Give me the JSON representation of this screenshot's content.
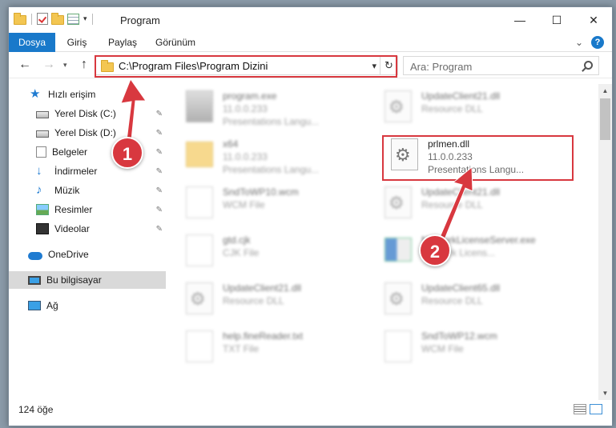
{
  "window": {
    "title": "Program",
    "minimize": "—",
    "maximize": "☐",
    "close": "✕"
  },
  "ribbon": {
    "tabs": [
      "Dosya",
      "Giriş",
      "Paylaş",
      "Görünüm"
    ],
    "expand_icon": "chevron-down-icon",
    "help_label": "?"
  },
  "navigation": {
    "back": "←",
    "forward": "→",
    "recent": "⌄",
    "up": "↑",
    "address": "C:\\Program Files\\Program Dizini",
    "address_dropdown": "⌄",
    "refresh": "↻",
    "search_placeholder": "Ara: Program"
  },
  "sidebar": {
    "items": [
      {
        "label": "Hızlı erişim",
        "icon": "star-icon",
        "pinned": false
      },
      {
        "label": "Yerel Disk (C:)",
        "icon": "drive-icon",
        "pinned": true
      },
      {
        "label": "Yerel Disk (D:)",
        "icon": "drive-icon",
        "pinned": true
      },
      {
        "label": "Belgeler",
        "icon": "documents-icon",
        "pinned": true
      },
      {
        "label": "İndirmeler",
        "icon": "downloads-icon",
        "pinned": true
      },
      {
        "label": "Müzik",
        "icon": "music-icon",
        "pinned": true
      },
      {
        "label": "Resimler",
        "icon": "pictures-icon",
        "pinned": true
      },
      {
        "label": "Videolar",
        "icon": "videos-icon",
        "pinned": true
      },
      {
        "label": "OneDrive",
        "icon": "onedrive-icon",
        "pinned": false
      },
      {
        "label": "Bu bilgisayar",
        "icon": "this-pc-icon",
        "pinned": false,
        "selected": true
      },
      {
        "label": "Ağ",
        "icon": "network-icon",
        "pinned": false
      }
    ],
    "pin_glyph": "📌"
  },
  "files": [
    {
      "name": "program.exe",
      "meta1": "11.0.0.233",
      "meta2": "Presentations Langu...",
      "icon": "exe-icon"
    },
    {
      "name": "UpdateClient21.dll",
      "meta1": "Resource DLL",
      "meta2": "",
      "icon": "dll-icon"
    },
    {
      "name": "x64",
      "meta1": "11.0.0.233",
      "meta2": "Presentations Langu...",
      "icon": "folder-icon"
    },
    {
      "name": "prlmen.dll",
      "meta1": "11.0.0.233",
      "meta2": "Presentations Langu...",
      "icon": "dll-icon",
      "highlighted": true
    },
    {
      "name": "SndToWP10.wcm",
      "meta1": "WCM File",
      "meta2": "",
      "icon": "file-icon"
    },
    {
      "name": "UpdateClient21.dll",
      "meta1": "Resource DLL",
      "meta2": "",
      "icon": "dll-icon"
    },
    {
      "name": "gtd.cjk",
      "meta1": "CJK File",
      "meta2": "",
      "icon": "file-icon"
    },
    {
      "name": "NetworkLicenseServer.exe",
      "meta1": "Network Licens...",
      "meta2": "",
      "icon": "app-icon"
    },
    {
      "name": "UpdateClient21.dll",
      "meta1": "Resource DLL",
      "meta2": "",
      "icon": "dll-icon"
    },
    {
      "name": "UpdateClient65.dll",
      "meta1": "Resource DLL",
      "meta2": "",
      "icon": "dll-icon"
    },
    {
      "name": "help.fineReader.txt",
      "meta1": "TXT File",
      "meta2": "",
      "icon": "file-icon"
    },
    {
      "name": "SndToWP12.wcm",
      "meta1": "WCM File",
      "meta2": "",
      "icon": "file-icon"
    }
  ],
  "status": {
    "item_count": "124 öğe"
  },
  "annotations": {
    "step1": "1",
    "step2": "2",
    "highlight_color": "#d8383f"
  }
}
